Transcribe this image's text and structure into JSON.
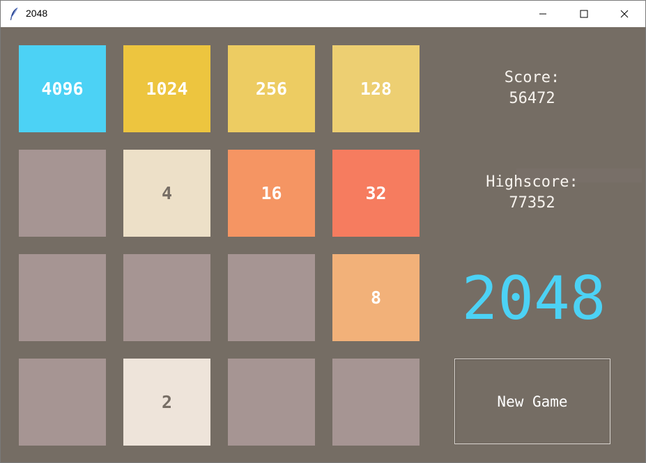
{
  "window": {
    "title": "2048"
  },
  "score": {
    "label": "Score:",
    "value": "56472"
  },
  "highscore": {
    "label": "Highscore:",
    "value": "77352"
  },
  "logo": "2048",
  "new_game_label": "New Game",
  "colors": {
    "background": "#756d64",
    "empty_tile": "#a69593",
    "accent": "#4cd2f5"
  },
  "board": [
    [
      {
        "value": "4096",
        "bg": "#4cd2f5",
        "fg": "#ffffff"
      },
      {
        "value": "1024",
        "bg": "#edc53f",
        "fg": "#ffffff"
      },
      {
        "value": "256",
        "bg": "#edcc62",
        "fg": "#ffffff"
      },
      {
        "value": "128",
        "bg": "#edcf72",
        "fg": "#ffffff"
      }
    ],
    [
      {
        "value": "",
        "bg": "#a69593",
        "fg": "#776e65"
      },
      {
        "value": "4",
        "bg": "#ede0c8",
        "fg": "#776e65"
      },
      {
        "value": "16",
        "bg": "#f59563",
        "fg": "#ffffff"
      },
      {
        "value": "32",
        "bg": "#f67c5f",
        "fg": "#ffffff"
      }
    ],
    [
      {
        "value": "",
        "bg": "#a69593",
        "fg": "#776e65"
      },
      {
        "value": "",
        "bg": "#a69593",
        "fg": "#776e65"
      },
      {
        "value": "",
        "bg": "#a69593",
        "fg": "#776e65"
      },
      {
        "value": "8",
        "bg": "#f2b179",
        "fg": "#ffffff"
      }
    ],
    [
      {
        "value": "",
        "bg": "#a69593",
        "fg": "#776e65"
      },
      {
        "value": "2",
        "bg": "#eee4da",
        "fg": "#776e65"
      },
      {
        "value": "",
        "bg": "#a69593",
        "fg": "#776e65"
      },
      {
        "value": "",
        "bg": "#a69593",
        "fg": "#776e65"
      }
    ]
  ]
}
